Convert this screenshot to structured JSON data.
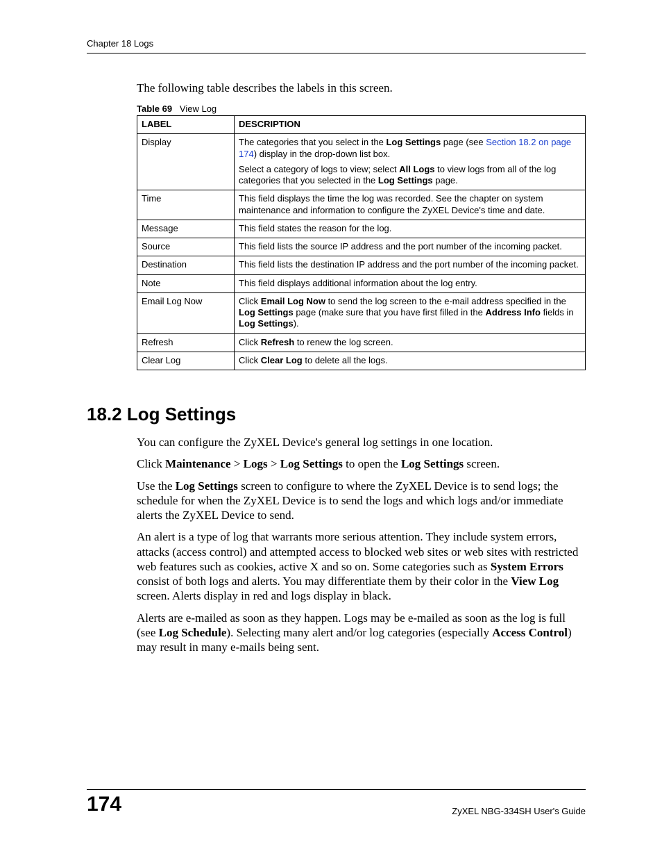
{
  "header": {
    "running_head": "Chapter 18 Logs"
  },
  "intro": "The following table describes the labels in this screen.",
  "table": {
    "caption_num": "Table 69",
    "caption_title": "View Log",
    "cols": {
      "label": "LABEL",
      "desc": "DESCRIPTION"
    },
    "rows": {
      "display": {
        "label": "Display",
        "p1a": "The categories that you select in the ",
        "p1b_bold": "Log Settings",
        "p1c": " page (see ",
        "p1_link": "Section 18.2 on page 174",
        "p1d": ") display in the drop-down list box.",
        "p2a": "Select a category of logs to view; select ",
        "p2b_bold": "All Logs",
        "p2c": " to view logs from all of the log categories that you selected in the ",
        "p2d_bold": "Log Settings",
        "p2e": " page."
      },
      "time": {
        "label": "Time",
        "desc": "This field displays the time the log was recorded. See the chapter on system maintenance and information to configure the ZyXEL Device's time and date."
      },
      "message": {
        "label": "Message",
        "desc": "This field states the reason for the log."
      },
      "source": {
        "label": "Source",
        "desc": "This field lists the source IP address and the port number of the incoming packet."
      },
      "destination": {
        "label": "Destination",
        "desc": "This field lists the destination IP address and the port number of the incoming packet."
      },
      "note": {
        "label": "Note",
        "desc": "This field displays additional information about the log entry."
      },
      "email_log_now": {
        "label": "Email Log Now",
        "a": "Click ",
        "b_bold": "Email Log Now",
        "c": " to send the log screen to the e-mail address specified in the ",
        "d_bold": "Log Settings",
        "e": " page (make sure that you have first filled in the ",
        "f_bold": "Address Info",
        "g": " fields in ",
        "h_bold": "Log Settings",
        "i": ")."
      },
      "refresh": {
        "label": "Refresh",
        "a": "Click ",
        "b_bold": "Refresh",
        "c": " to renew the log screen."
      },
      "clear_log": {
        "label": "Clear Log",
        "a": "Click ",
        "b_bold": "Clear Log",
        "c": " to delete all the logs."
      }
    }
  },
  "section": {
    "heading": "18.2  Log Settings",
    "p1": "You can configure the ZyXEL Device's general log settings in one location.",
    "p2": {
      "a": "Click ",
      "b": "Maintenance",
      "c": " > ",
      "d": "Logs",
      "e": " > ",
      "f": "Log Settings",
      "g": " to open the ",
      "h": "Log Settings",
      "i": " screen."
    },
    "p3": {
      "a": "Use the ",
      "b": "Log Settings",
      "c": " screen to configure to where the ZyXEL Device is to send logs; the schedule for when the ZyXEL Device is to send the logs and which logs and/or immediate alerts the ZyXEL Device to send."
    },
    "p4": {
      "a": "An alert is a type of log that warrants more serious attention. They include system errors, attacks (access control) and attempted access to blocked web sites or web sites with restricted web features such as cookies, active X and so on. Some categories such as ",
      "b": "System Errors",
      "c": " consist of both logs and alerts. You may differentiate them by their color in the ",
      "d": "View Log",
      "e": " screen. Alerts display in red and logs display in black."
    },
    "p5": {
      "a": "Alerts are e-mailed as soon as they happen. Logs may be e-mailed as soon as the log is full (see ",
      "b": "Log Schedule",
      "c": "). Selecting many alert and/or log categories (especially ",
      "d": "Access Control",
      "e": ") may result in many e-mails being sent."
    }
  },
  "footer": {
    "page": "174",
    "guide": "ZyXEL NBG-334SH User's Guide"
  }
}
